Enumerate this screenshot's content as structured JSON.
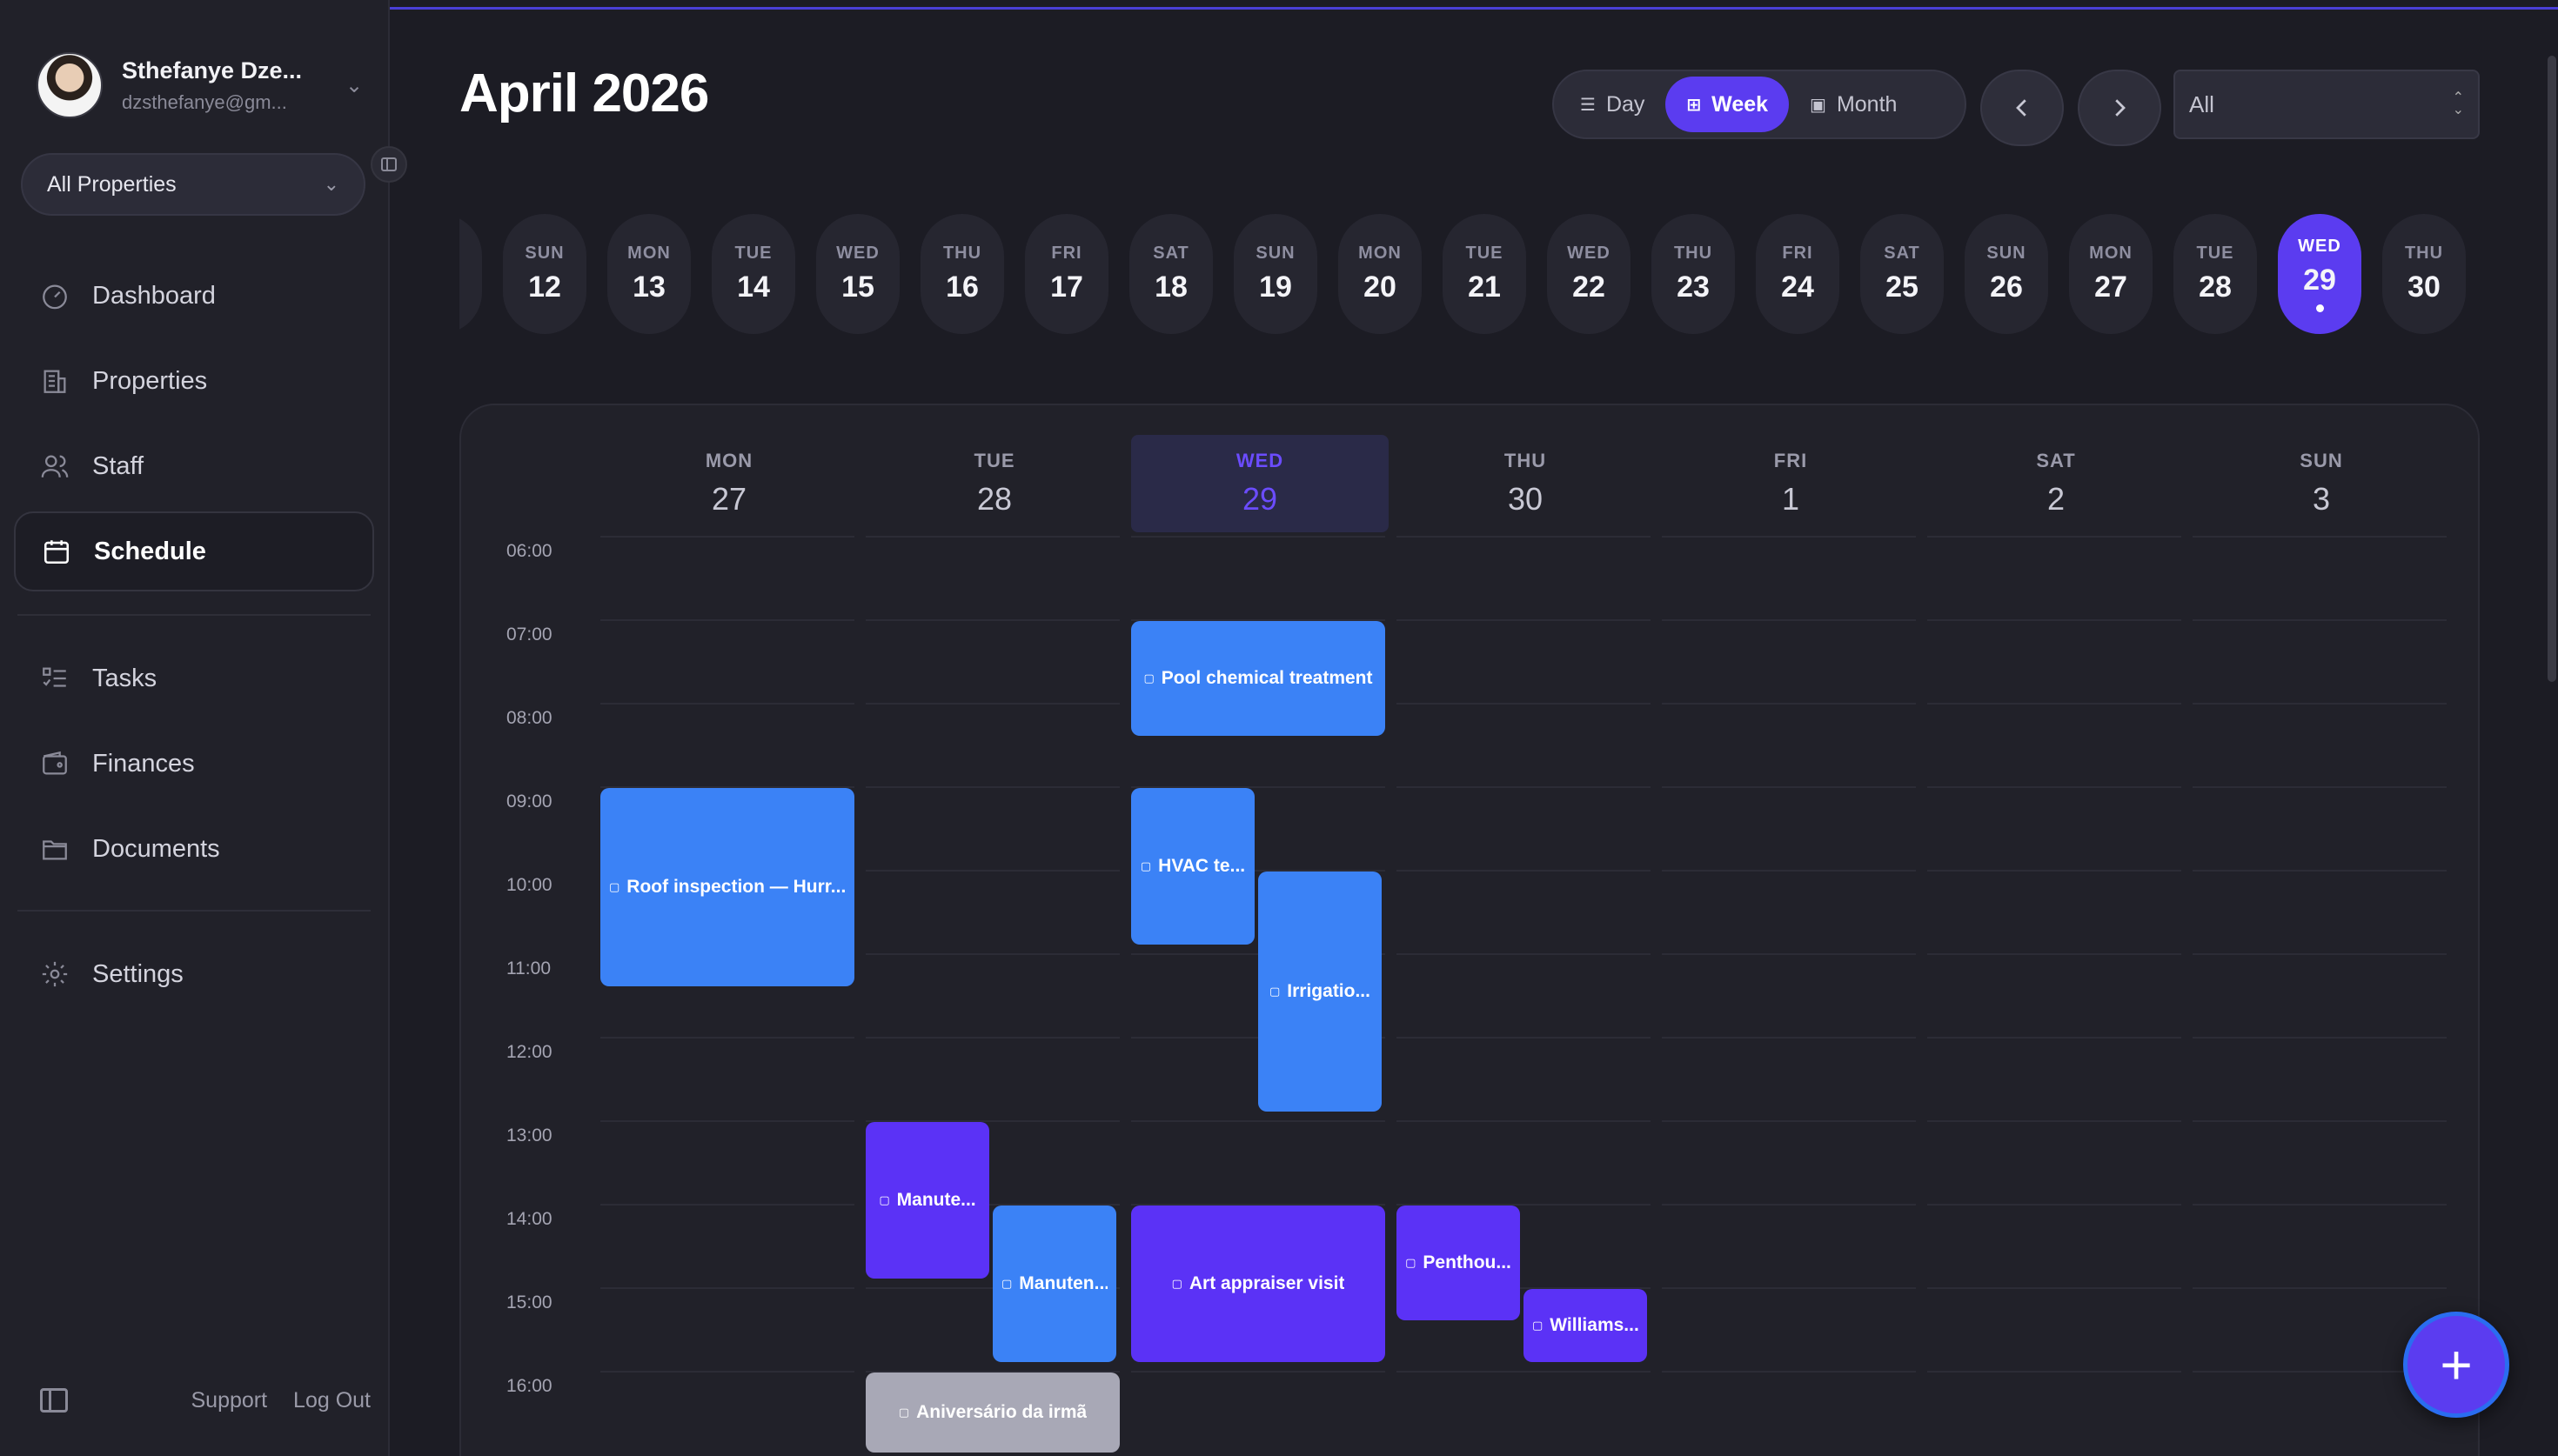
{
  "user": {
    "name": "Sthefanye Dze...",
    "email": "dzsthefanye@gm..."
  },
  "property_select": {
    "value": "All Properties"
  },
  "nav": {
    "dashboard": "Dashboard",
    "properties": "Properties",
    "staff": "Staff",
    "schedule": "Schedule",
    "tasks": "Tasks",
    "finances": "Finances",
    "documents": "Documents",
    "settings": "Settings"
  },
  "footer": {
    "support": "Support",
    "logout": "Log Out"
  },
  "header": {
    "title": "April 2026",
    "views": {
      "day": "Day",
      "week": "Week",
      "month": "Month"
    },
    "active_view": "Week",
    "filter": "All"
  },
  "date_strip": [
    {
      "dow": "SUN",
      "day": "12"
    },
    {
      "dow": "MON",
      "day": "13"
    },
    {
      "dow": "TUE",
      "day": "14"
    },
    {
      "dow": "WED",
      "day": "15"
    },
    {
      "dow": "THU",
      "day": "16"
    },
    {
      "dow": "FRI",
      "day": "17"
    },
    {
      "dow": "SAT",
      "day": "18"
    },
    {
      "dow": "SUN",
      "day": "19"
    },
    {
      "dow": "MON",
      "day": "20"
    },
    {
      "dow": "TUE",
      "day": "21"
    },
    {
      "dow": "WED",
      "day": "22"
    },
    {
      "dow": "THU",
      "day": "23"
    },
    {
      "dow": "FRI",
      "day": "24"
    },
    {
      "dow": "SAT",
      "day": "25"
    },
    {
      "dow": "SUN",
      "day": "26"
    },
    {
      "dow": "MON",
      "day": "27"
    },
    {
      "dow": "TUE",
      "day": "28"
    },
    {
      "dow": "WED",
      "day": "29",
      "selected": true
    },
    {
      "dow": "THU",
      "day": "30"
    }
  ],
  "week_columns": [
    {
      "dow": "MON",
      "day": "27"
    },
    {
      "dow": "TUE",
      "day": "28"
    },
    {
      "dow": "WED",
      "day": "29",
      "today": true
    },
    {
      "dow": "THU",
      "day": "30"
    },
    {
      "dow": "FRI",
      "day": "1"
    },
    {
      "dow": "SAT",
      "day": "2"
    },
    {
      "dow": "SUN",
      "day": "3"
    }
  ],
  "time_labels": [
    "06:00",
    "07:00",
    "08:00",
    "09:00",
    "10:00",
    "11:00",
    "12:00",
    "13:00",
    "14:00",
    "15:00",
    "16:00"
  ],
  "events": [
    {
      "title": "Pool chemical treatment",
      "day": 2,
      "start": "07:00",
      "end": "08:25",
      "color": "#3b82f6"
    },
    {
      "title": "Roof inspection — Hurr...",
      "day": 0,
      "start": "09:00",
      "end": "11:25",
      "color": "#3b82f6"
    },
    {
      "title": "HVAC te...",
      "day": 2,
      "start": "09:00",
      "end": "10:55",
      "color": "#3b82f6"
    },
    {
      "title": "Irrigatio...",
      "day": 2,
      "start": "10:00",
      "end": "12:55",
      "color": "#3b82f6"
    },
    {
      "title": "Manute...",
      "day": 1,
      "start": "13:00",
      "end": "14:55",
      "color": "#5b32f6"
    },
    {
      "title": "Manuten...",
      "day": 1,
      "start": "14:00",
      "end": "15:55",
      "color": "#3b82f6"
    },
    {
      "title": "Art appraiser visit",
      "day": 2,
      "start": "14:00",
      "end": "15:55",
      "color": "#5b32f6"
    },
    {
      "title": "Penthou...",
      "day": 3,
      "start": "14:00",
      "end": "15:25",
      "color": "#5b32f6"
    },
    {
      "title": "Williams...",
      "day": 3,
      "start": "15:00",
      "end": "15:55",
      "color": "#5b32f6"
    },
    {
      "title": "Aniversário da irmã",
      "day": 1,
      "start": "16:00",
      "end": "17:00",
      "color": "#a8a8b6"
    }
  ],
  "colors": {
    "accent": "#5b3cf0",
    "event_blue": "#3b82f6",
    "event_purple": "#5b32f6",
    "background": "#1c1c24"
  }
}
